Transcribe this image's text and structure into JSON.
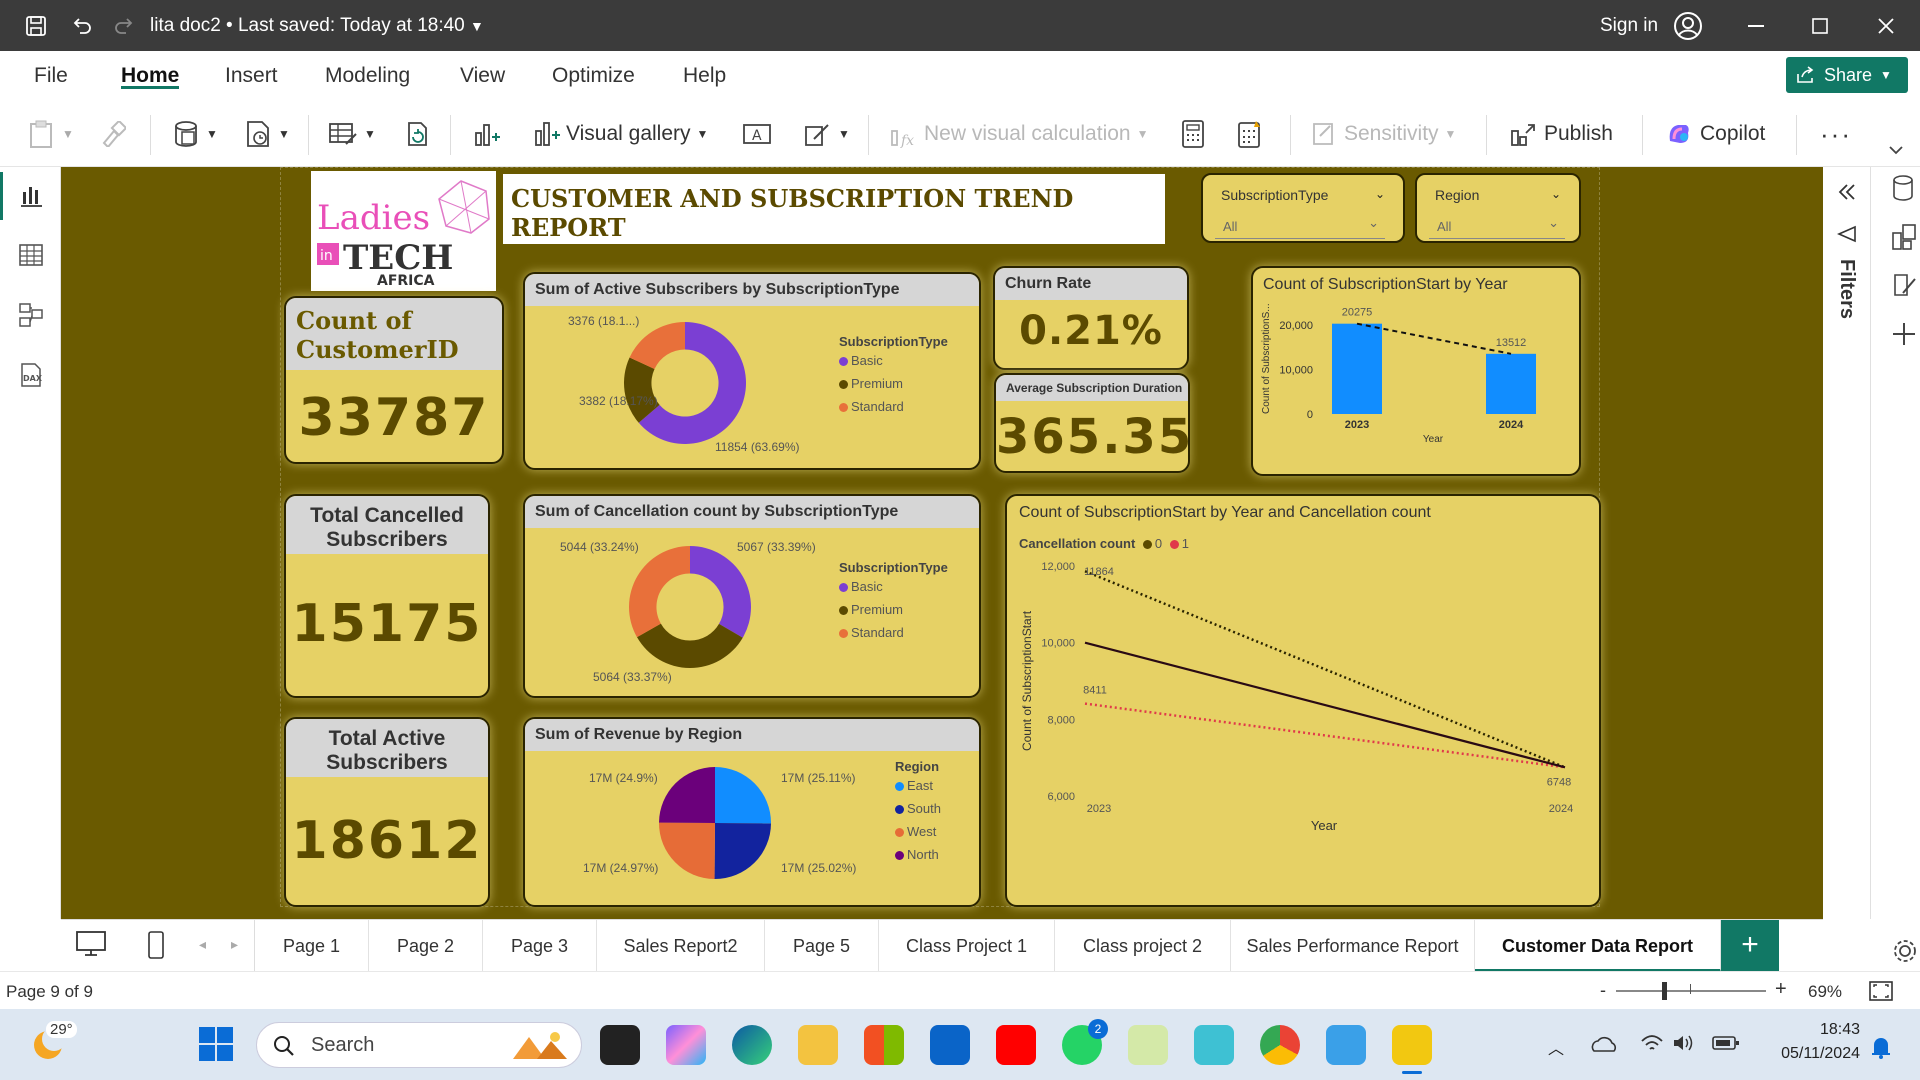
{
  "titlebar": {
    "doc_title": "lita doc2 • Last saved: Today at 18:40",
    "sign_in": "Sign in"
  },
  "menu": [
    "File",
    "Home",
    "Insert",
    "Modeling",
    "View",
    "Optimize",
    "Help"
  ],
  "share_label": "Share",
  "ribbon": {
    "visual_gallery": "Visual gallery",
    "new_visual_calc": "New visual calculation",
    "sensitivity": "Sensitivity",
    "publish": "Publish",
    "copilot": "Copilot"
  },
  "report": {
    "title": "CUSTOMER AND SUBSCRIPTION TREND REPORT",
    "logo": {
      "line1": "Ladies",
      "in": "in",
      "line2": "TECH",
      "line3": "AFRICA"
    },
    "slicers": [
      {
        "title": "SubscriptionType",
        "value": "All"
      },
      {
        "title": "Region",
        "value": "All"
      }
    ],
    "kpis": {
      "customer_count": {
        "label": "Count of CustomerID",
        "value": "33787"
      },
      "cancelled": {
        "label": "Total Cancelled Subscribers",
        "value": "15175"
      },
      "active": {
        "label": "Total Active Subscribers",
        "value": "18612"
      },
      "churn": {
        "label": "Churn Rate",
        "value": "0.21%"
      },
      "avg_duration": {
        "label": "Average Subscription Duration",
        "value": "365.35"
      }
    }
  },
  "chart_data": [
    {
      "type": "donut",
      "title": "Sum of Active Subscribers by SubscriptionType",
      "legend_title": "SubscriptionType",
      "categories": [
        "Basic",
        "Premium",
        "Standard"
      ],
      "values": [
        11854,
        3382,
        3376
      ],
      "data_labels": [
        "11854 (63.69%)",
        "3382 (18.17%)",
        "3376 (18.1...)"
      ],
      "colors": [
        "#7b3fd3",
        "#5b4a00",
        "#e8703a"
      ]
    },
    {
      "type": "donut",
      "title": "Sum of Cancellation count by SubscriptionType",
      "legend_title": "SubscriptionType",
      "categories": [
        "Basic",
        "Premium",
        "Standard"
      ],
      "values": [
        5067,
        5064,
        5044
      ],
      "data_labels": [
        "5067 (33.39%)",
        "5064 (33.37%)",
        "5044 (33.24%)"
      ],
      "colors": [
        "#7b3fd3",
        "#5b4a00",
        "#e8703a"
      ]
    },
    {
      "type": "pie",
      "title": "Sum of Revenue by Region",
      "legend_title": "Region",
      "categories": [
        "East",
        "South",
        "West",
        "North"
      ],
      "values": [
        25.11,
        25.02,
        24.97,
        24.9
      ],
      "data_labels": [
        "17M (25.11%)",
        "17M (25.02%)",
        "17M (24.97%)",
        "17M (24.9%)"
      ],
      "colors": [
        "#118dff",
        "#12239e",
        "#e66c37",
        "#6b007b"
      ]
    },
    {
      "type": "bar",
      "title": "Count of SubscriptionStart by Year",
      "xlabel": "Year",
      "ylabel": "Count of SubscriptionS...",
      "categories": [
        "2023",
        "2024"
      ],
      "values": [
        20275,
        13512
      ],
      "ylim": [
        0,
        20000
      ],
      "yticks": [
        "0",
        "10,000",
        "20,000"
      ],
      "trendline": true
    },
    {
      "type": "line",
      "title": "Count of SubscriptionStart by Year and Cancellation count",
      "legend_title": "Cancellation count",
      "xlabel": "Year",
      "ylabel": "Count of SubscriptionStart",
      "categories": [
        "2023",
        "2024"
      ],
      "ylim": [
        6000,
        12000
      ],
      "yticks": [
        "6,000",
        "8,000",
        "10,000",
        "12,000"
      ],
      "series": [
        {
          "name": "0",
          "values": [
            11864,
            6748
          ],
          "color": "#2a2400"
        },
        {
          "name": "1",
          "values": [
            8411,
            6748
          ],
          "color": "#e03a4a"
        }
      ],
      "point_labels": [
        "11864",
        "8411",
        "6748"
      ]
    }
  ],
  "tabs": [
    "Page 1",
    "Page 2",
    "Page 3",
    "Sales Report2",
    "Page 5",
    "Class Project 1",
    "Class project 2",
    "Sales Performance Report",
    "Customer Data Report"
  ],
  "status": {
    "page": "Page 9 of 9",
    "zoom": "69%"
  },
  "filters_label": "Filters",
  "taskbar": {
    "temp": "29°",
    "search": "Search",
    "time": "18:43",
    "date": "05/11/2024",
    "whatsapp_badge": "2"
  }
}
